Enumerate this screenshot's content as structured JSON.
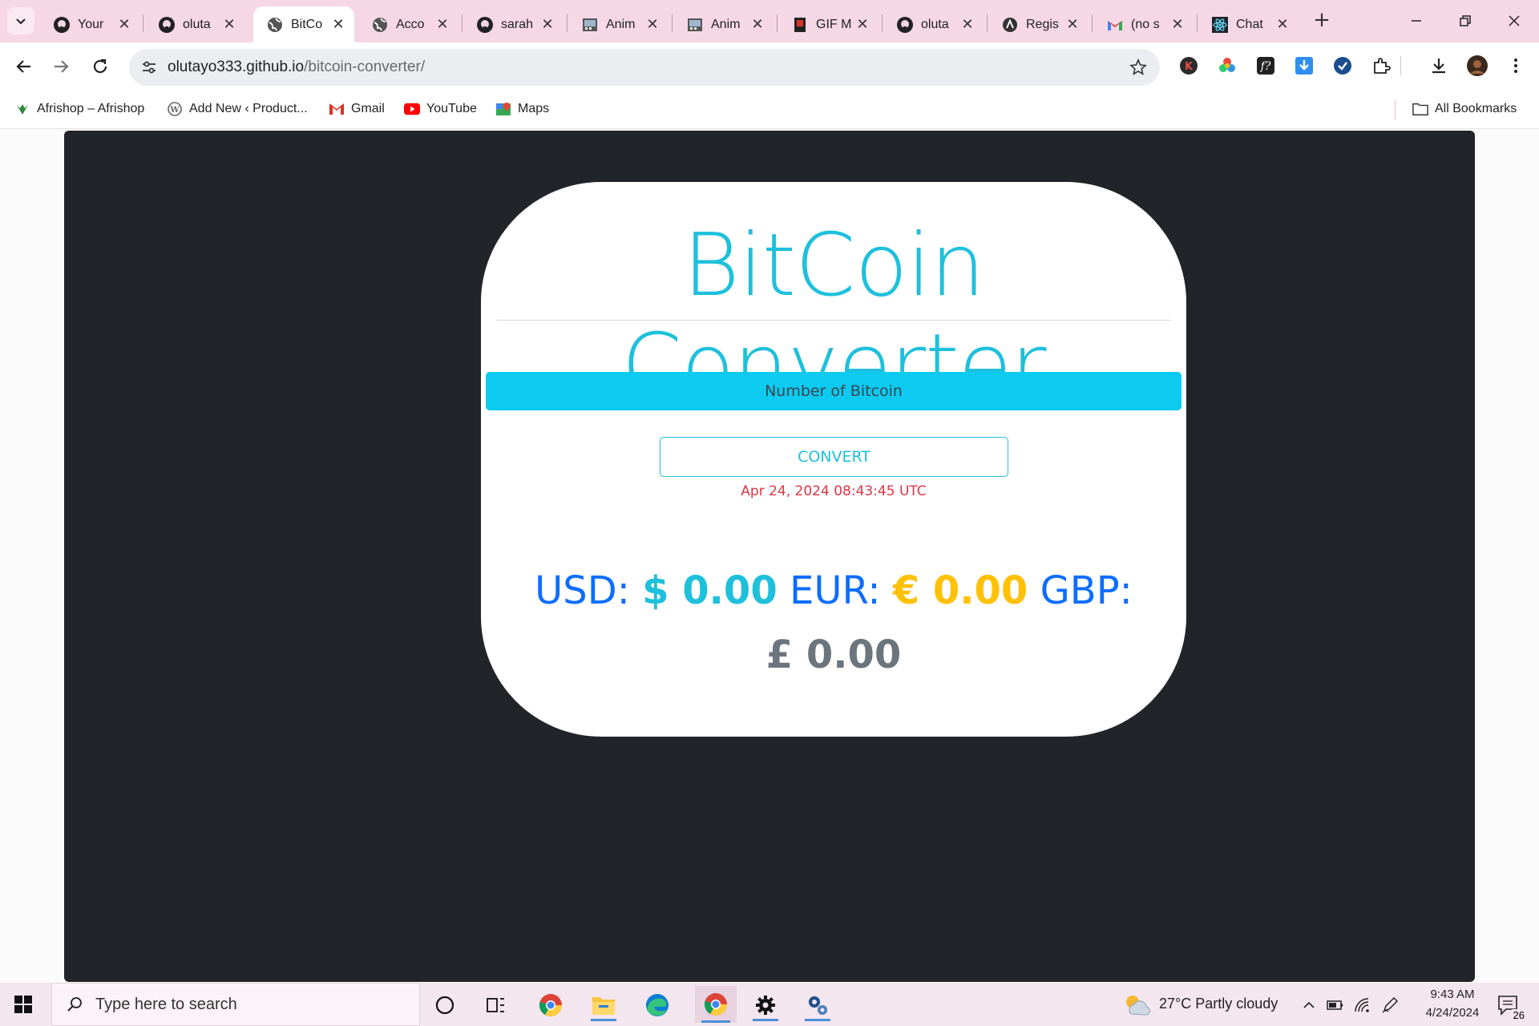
{
  "browser": {
    "tabs": [
      {
        "title": "Your",
        "icon": "github-icon"
      },
      {
        "title": "oluta",
        "icon": "github-icon"
      },
      {
        "title": "BitCo",
        "icon": "globe-icon"
      },
      {
        "title": "Acco",
        "icon": "globe-icon"
      },
      {
        "title": "sarah",
        "icon": "github-icon"
      },
      {
        "title": "Anim",
        "icon": "image-icon"
      },
      {
        "title": "Anim",
        "icon": "image-icon"
      },
      {
        "title": "GIF M",
        "icon": "gif-icon"
      },
      {
        "title": "oluta",
        "icon": "github-icon"
      },
      {
        "title": "Regis",
        "icon": "app-icon"
      },
      {
        "title": "(no s",
        "icon": "gmail-icon"
      },
      {
        "title": "Chat",
        "icon": "react-icon"
      }
    ],
    "active_tab_index": 2,
    "url_host": "olutayo333.github.io",
    "url_path": "/bitcoin-converter/",
    "bookmarks": [
      {
        "label": "Afrishop – Afrishop",
        "icon": "afrishop-icon"
      },
      {
        "label": "Add New ‹ Product...",
        "icon": "wordpress-icon"
      },
      {
        "label": "Gmail",
        "icon": "gmail-icon"
      },
      {
        "label": "YouTube",
        "icon": "youtube-icon"
      },
      {
        "label": "Maps",
        "icon": "maps-icon"
      }
    ],
    "all_bookmarks_label": "All Bookmarks"
  },
  "app": {
    "title": "BitCoin Converter",
    "input_placeholder": "Number of Bitcoin",
    "convert_label": "CONVERT",
    "timestamp": "Apr 24, 2024 08:43:45 UTC",
    "usd_label": "USD:",
    "usd_value": "$ 0.00",
    "eur_label": "EUR:",
    "eur_value": "€ 0.00",
    "gbp_label": "GBP:",
    "gbp_value": "£ 0.00",
    "colors": {
      "title": "#1ec0dc",
      "input_bg": "#0dcaf0",
      "timestamp": "#dc3545",
      "label": "#0d6efd",
      "eur": "#ffc107",
      "gbp": "#6c757d",
      "background": "#212529"
    }
  },
  "taskbar": {
    "search_placeholder": "Type here to search",
    "weather": "27°C  Partly cloudy",
    "time": "9:43 AM",
    "date": "4/24/2024",
    "notification_count": "26"
  }
}
